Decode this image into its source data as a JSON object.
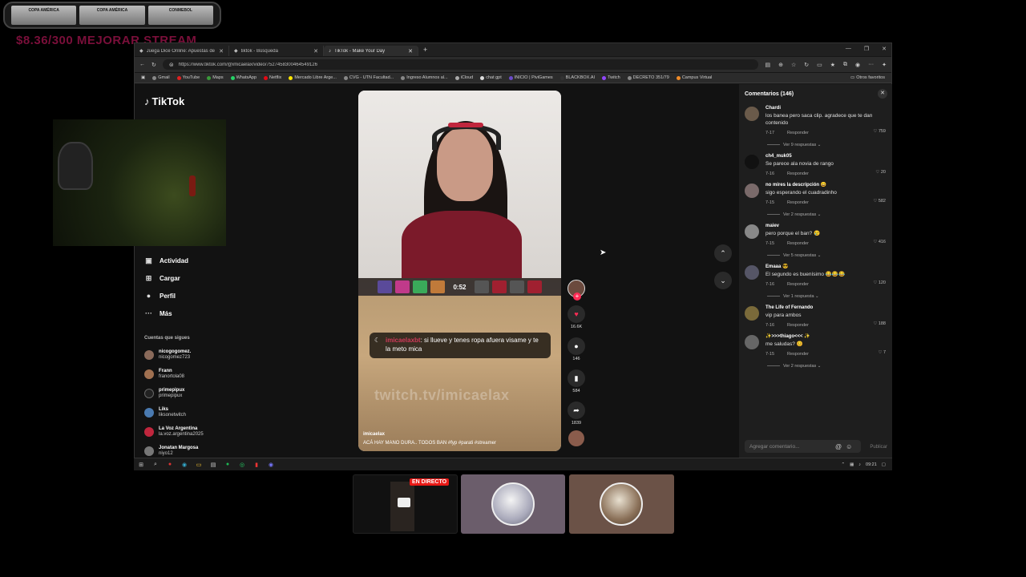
{
  "overlay": {
    "banner_tiles": [
      "COPA AMÉRICA",
      "COPA AMÉRICA",
      "CONMEBOL"
    ],
    "goal_text": "$8.36/300 MEJORAR STREAM"
  },
  "browser": {
    "tabs": [
      {
        "label": "Juega Dice Online: Apuestas de D..."
      },
      {
        "label": "tiktok - Búsqueda"
      },
      {
        "label": "TikTok - Make Your Day"
      }
    ],
    "new_tab": "+",
    "url": "https://www.tiktok.com/@imicaelax/video/7527458300464549126",
    "bookmarks": [
      "Gmail",
      "YouTube",
      "Maps",
      "WhatsApp",
      "Netflix",
      "Mercado Libre Arge...",
      "CVG - UTN Facultad...",
      "Ingreso Alumnos al...",
      "iCloud",
      "chat gpt",
      "INICIO | PiviGames",
      "BLACKBOX.AI",
      "Twitch",
      "DECRETO 351/79",
      "Campus Virtual"
    ],
    "bookmarks_other": "Otros favoritos"
  },
  "tiktok": {
    "logo_text": "TikTok",
    "nav": [
      {
        "label": "Actividad",
        "icon": "▣"
      },
      {
        "label": "Cargar",
        "icon": "⊞"
      },
      {
        "label": "Perfil",
        "icon": "●"
      },
      {
        "label": "Más",
        "icon": "···"
      }
    ],
    "following_title": "Cuentas que sigues",
    "following": [
      {
        "name": "nicogogomez.",
        "handle": "nicogomez723"
      },
      {
        "name": "Frann",
        "handle": "franortola08"
      },
      {
        "name": "primepipux",
        "handle": "primepipux"
      },
      {
        "name": "Liks",
        "handle": "liksonetwitch"
      },
      {
        "name": "La Voz Argentina",
        "handle": "la.voz.argentina2025"
      },
      {
        "name": "Jonatan Margosa",
        "handle": "niyo12"
      }
    ],
    "video": {
      "hud_timer": "0:52",
      "chat_user": "imicaelaxbt",
      "chat_text": ": si llueve y tenes ropa afuera visame y te la meto mica",
      "watermark": "twitch.tv/imicaelax",
      "author": "imicaelax",
      "caption": "ACÁ HAY MANO DURA.. TODOS BAN #fyp #parati #streamer",
      "likes": "16.6K",
      "comments": "146",
      "saves": "584",
      "shares": "1839"
    },
    "comments_panel": {
      "title": "Comentarios (146)",
      "close": "✕",
      "reply_label": "Responder",
      "items": [
        {
          "user": "Chardi",
          "text": "los banea pero saca clip. agradece que te dan contenido",
          "date": "7-17",
          "likes": "759",
          "replies": "Ver 9 respuestas ⌄"
        },
        {
          "user": "ch4_muk05",
          "text": "Se parece ala novia de rango",
          "date": "7-16",
          "likes": "20",
          "replies": ""
        },
        {
          "user": "no mires la descripción 😄",
          "text": "sigo esperando el cuadradinho",
          "date": "7-15",
          "likes": "582",
          "replies": "Ver 2 respuestas ⌄"
        },
        {
          "user": "maiev",
          "text": "pero porque el ban? 😢",
          "date": "7-15",
          "likes": "416",
          "replies": "Ver 5 respuestas ⌄"
        },
        {
          "user": "Emaaa 😎",
          "text": "El segundo es buenísimo 😂😂😂",
          "date": "7-16",
          "likes": "120",
          "replies": "Ver 1 respuesta ⌄"
        },
        {
          "user": "The Life of Fernando",
          "text": "vip para ambos",
          "date": "7-16",
          "likes": "188",
          "replies": ""
        },
        {
          "user": "✨>>>thiago<<< ✨",
          "text": "me saludas? 😊",
          "date": "7-15",
          "likes": "7",
          "replies": "Ver 2 respuestas ⌄"
        }
      ],
      "input_placeholder": "Agregar comentario...",
      "publish": "Publicar"
    }
  },
  "taskbar": {
    "time": "09:21"
  },
  "previews": {
    "live_badge": "EN DIRECTO"
  },
  "colors": {
    "tiktok_red": "#fe2c55",
    "live_red": "#e91916"
  }
}
